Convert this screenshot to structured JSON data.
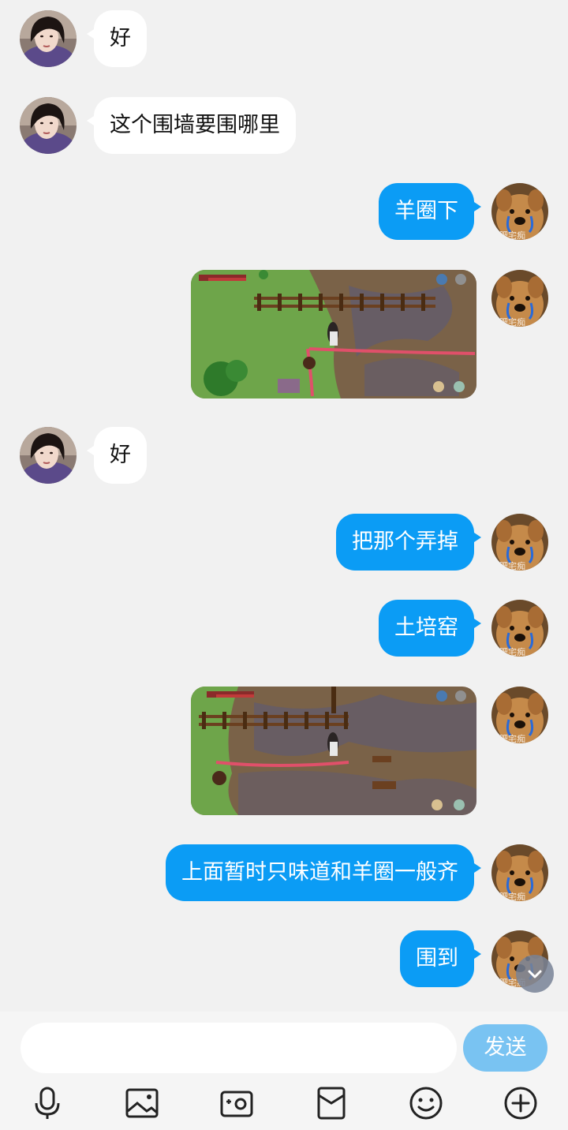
{
  "messages": [
    {
      "side": "in",
      "text": "好"
    },
    {
      "side": "in",
      "text": "这个围墙要围哪里"
    },
    {
      "side": "out",
      "text": "羊圈下"
    },
    {
      "side": "out",
      "type": "image",
      "description": "game-screenshot-1"
    },
    {
      "side": "in",
      "text": "好"
    },
    {
      "side": "out",
      "text": "把那个弄掉"
    },
    {
      "side": "out",
      "text": "土培窑"
    },
    {
      "side": "out",
      "type": "image",
      "description": "game-screenshot-2"
    },
    {
      "side": "out",
      "text": "上面暂时只味道和羊圈一般齐"
    },
    {
      "side": "out",
      "text": "围到"
    }
  ],
  "avatar_watermark": "肥宅痴",
  "composer": {
    "input_value": "",
    "send_label": "发送"
  },
  "toolbar": {
    "icons": [
      "microphone-icon",
      "image-icon",
      "camera-icon",
      "red-packet-icon",
      "emoji-icon",
      "plus-icon"
    ]
  },
  "colors": {
    "outgoing_bubble": "#0b9cf5",
    "incoming_bubble": "#ffffff",
    "background": "#f1f1f1",
    "send_button": "#79c3f2"
  }
}
